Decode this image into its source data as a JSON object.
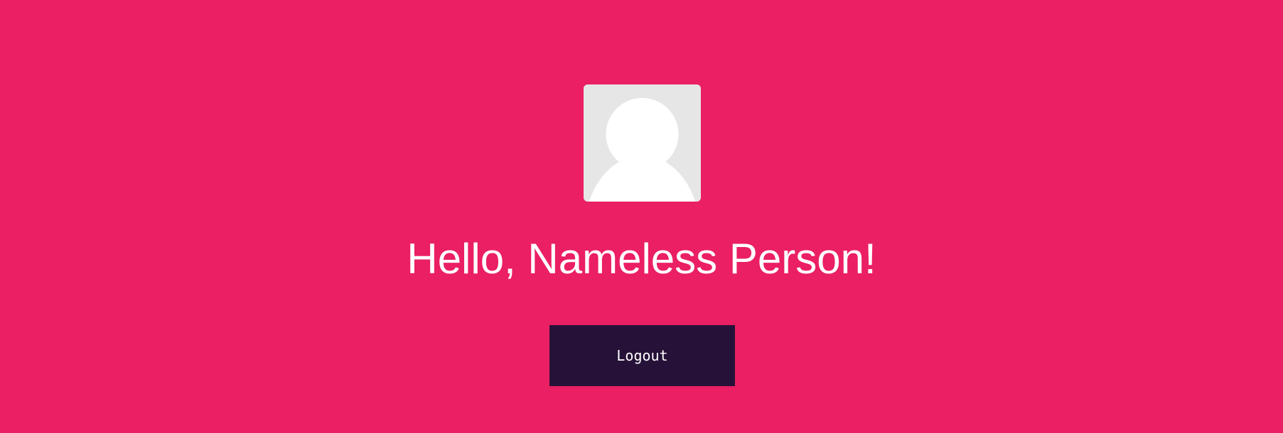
{
  "colors": {
    "background": "#EB1F63",
    "avatar_background": "#E6E6E6",
    "avatar_figure": "#FFFFFF",
    "button_background": "#261238",
    "text": "#FFFFFF"
  },
  "profile": {
    "avatar_icon": "default-user-avatar-icon",
    "greeting": "Hello, Nameless Person!"
  },
  "actions": {
    "logout_label": "Logout"
  }
}
